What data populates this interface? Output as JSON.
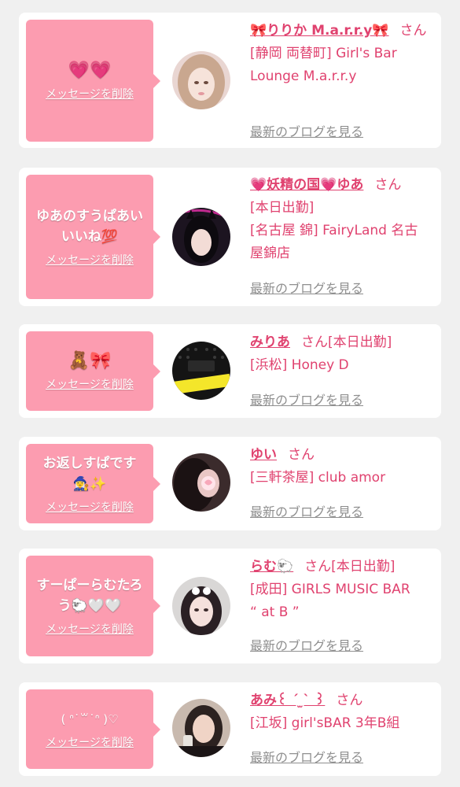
{
  "delete_label": "メッセージを削除",
  "blog_label": "最新のブログを見る",
  "san": "さん",
  "colors": {
    "accent": "#e0426f",
    "bubble": "#fc9cb0",
    "link_gray": "#8f8f8f",
    "background": "#f0f0f0"
  },
  "items": [
    {
      "message": "💗💗",
      "name": "🎀りりか M.a.r.r.y🎀",
      "san_suffix": "",
      "line1": "[静岡 両替町] Girl's Bar",
      "line2": "Lounge M.a.r.r.y",
      "line3": ""
    },
    {
      "message": "ゆあのすうぱあい いいね💯",
      "name": "💗妖精の国💗ゆあ",
      "san_suffix": "",
      "line1": "[本日出勤]",
      "line2": "[名古屋 錦] FairyLand 名古",
      "line3": "屋錦店"
    },
    {
      "message": "🧸🎀",
      "name": "みりあ",
      "san_suffix": "[本日出勤]",
      "line1": "[浜松] Honey D",
      "line2": "",
      "line3": ""
    },
    {
      "message": "お返しすぱです 🧙‍♀️✨",
      "name": "ゆい",
      "san_suffix": "",
      "line1": "[三軒茶屋] club amor",
      "line2": "",
      "line3": ""
    },
    {
      "message": "すーぱーらむたろ う🐑🤍🤍",
      "name": "らむ🐑",
      "san_suffix": "[本日出勤]",
      "line1": "[成田] GIRLS MUSIC BAR",
      "line2": "“ at B ”",
      "line3": ""
    },
    {
      "message": "( ᐢ˙꒳˙ᐢ )♡",
      "name": "あみ꒰ ˊ ̫ˋ ꒱",
      "san_suffix": "",
      "line1": "[江坂] girl'sBAR 3年B組",
      "line2": "",
      "line3": ""
    }
  ]
}
